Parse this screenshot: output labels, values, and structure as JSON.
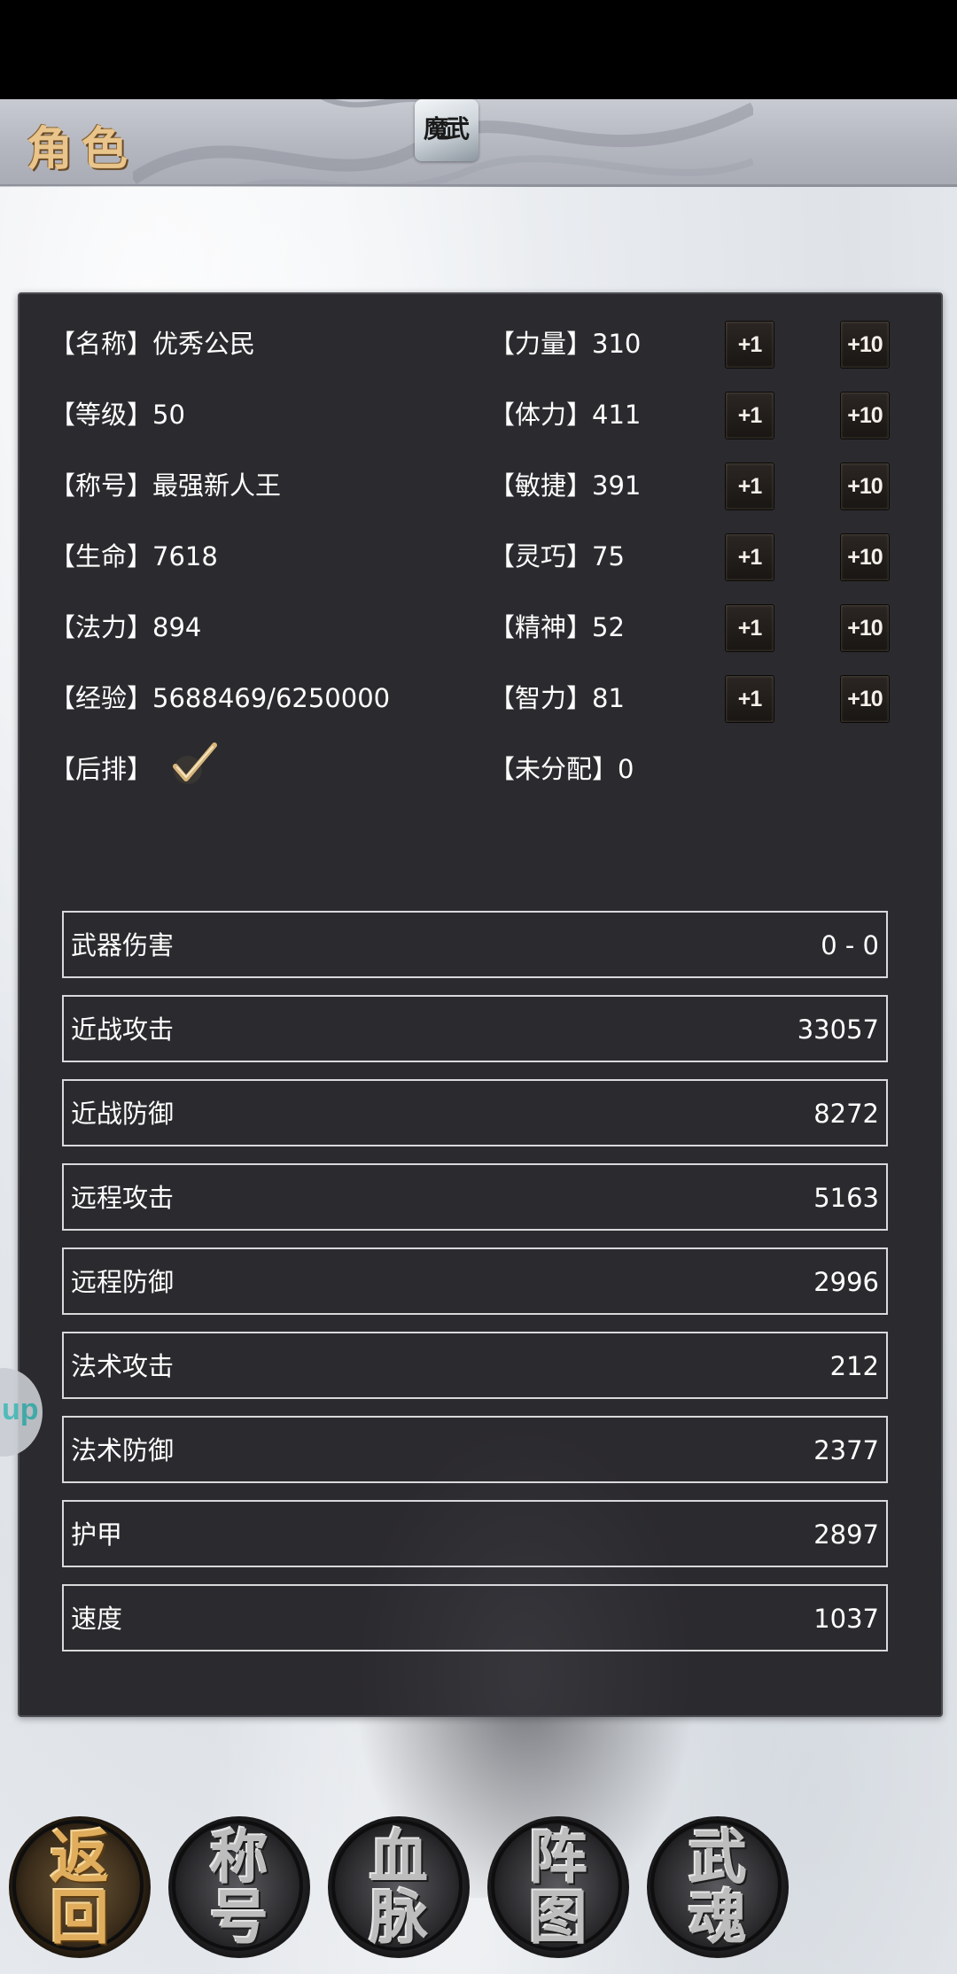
{
  "header": {
    "title": "角色",
    "logo_text": "魔武"
  },
  "info": {
    "name": {
      "label": "【名称】",
      "value": "优秀公民"
    },
    "level": {
      "label": "【等级】",
      "value": "50"
    },
    "title": {
      "label": "【称号】",
      "value": "最强新人王"
    },
    "hp": {
      "label": "【生命】",
      "value": "7618"
    },
    "mp": {
      "label": "【法力】",
      "value": "894"
    },
    "exp": {
      "label": "【经验】",
      "value": "5688469/6250000"
    },
    "back_row": {
      "label": "【后排】",
      "checked": true
    }
  },
  "attributes": [
    {
      "label": "【力量】",
      "value": "310",
      "plus1": "+1",
      "plus10": "+10"
    },
    {
      "label": "【体力】",
      "value": "411",
      "plus1": "+1",
      "plus10": "+10"
    },
    {
      "label": "【敏捷】",
      "value": "391",
      "plus1": "+1",
      "plus10": "+10"
    },
    {
      "label": "【灵巧】",
      "value": "75",
      "plus1": "+1",
      "plus10": "+10"
    },
    {
      "label": "【精神】",
      "value": "52",
      "plus1": "+1",
      "plus10": "+10"
    },
    {
      "label": "【智力】",
      "value": "81",
      "plus1": "+1",
      "plus10": "+10"
    }
  ],
  "unallocated": {
    "label": "【未分配】",
    "value": "0"
  },
  "derived_stats": [
    {
      "name": "武器伤害",
      "value": "0 - 0"
    },
    {
      "name": "近战攻击",
      "value": "33057"
    },
    {
      "name": "近战防御",
      "value": "8272"
    },
    {
      "name": "远程攻击",
      "value": "5163"
    },
    {
      "name": "远程防御",
      "value": "2996"
    },
    {
      "name": "法术攻击",
      "value": "212"
    },
    {
      "name": "法术防御",
      "value": "2377"
    },
    {
      "name": "护甲",
      "value": "2897"
    },
    {
      "name": "速度",
      "value": "1037"
    }
  ],
  "float_tab": {
    "text": "up"
  },
  "bottom_nav": [
    {
      "top": "返",
      "bottom": "回",
      "active": true
    },
    {
      "top": "称",
      "bottom": "号",
      "active": false
    },
    {
      "top": "血",
      "bottom": "脉",
      "active": false
    },
    {
      "top": "阵",
      "bottom": "图",
      "active": false
    },
    {
      "top": "武",
      "bottom": "魂",
      "active": false
    }
  ],
  "colors": {
    "panel_bg": "#2b2a2e",
    "header_title": "#e9c58c",
    "active_nav": "#e0ad5c"
  }
}
